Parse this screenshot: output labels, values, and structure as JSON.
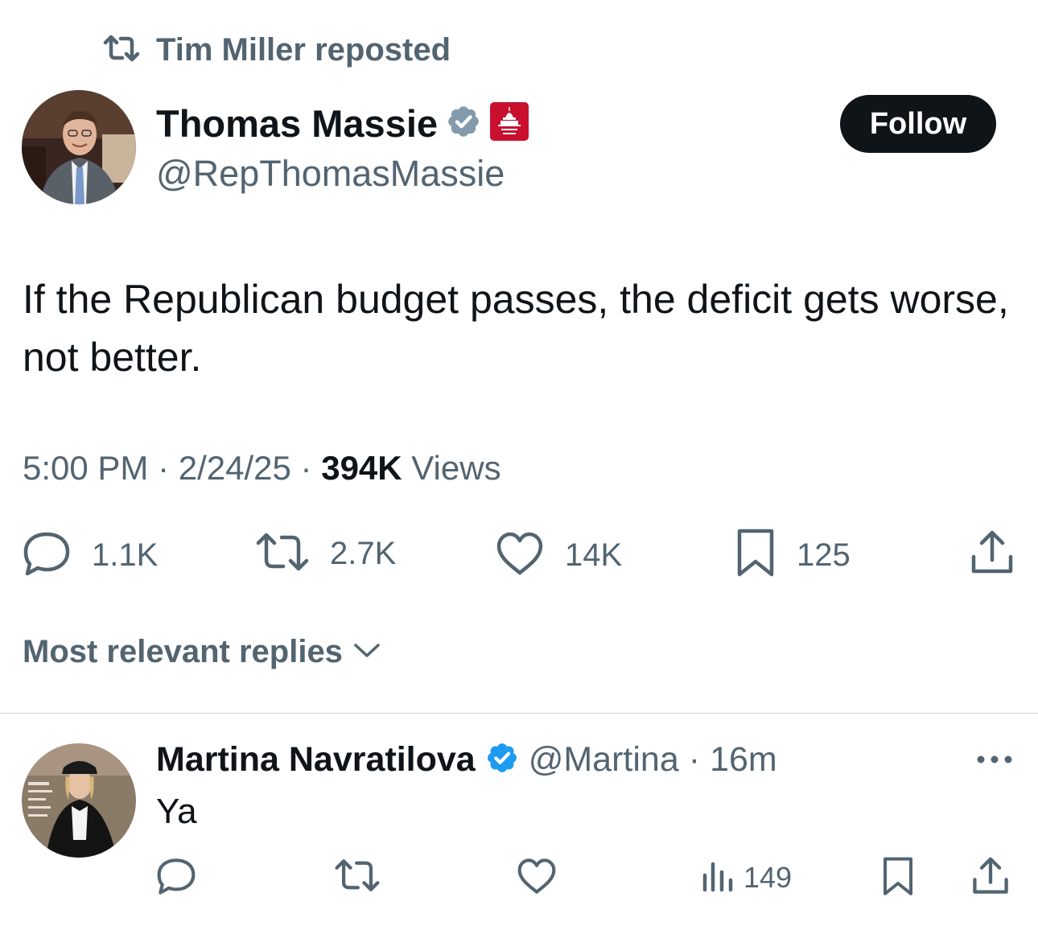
{
  "repost": {
    "text": "Tim Miller reposted",
    "icon": "repost-icon"
  },
  "tweet": {
    "author_name": "Thomas Massie",
    "handle": "@RepThomasMassie",
    "affiliation_badge": "HOUSE GOP",
    "follow_label": "Follow",
    "text": "If the Republican budget passes, the deficit gets worse, not better.",
    "time": "5:00 PM",
    "date": "2/24/25",
    "views_count": "394K",
    "views_label": "Views",
    "stats": {
      "replies": "1.1K",
      "reposts": "2.7K",
      "likes": "14K",
      "bookmarks": "125"
    }
  },
  "replies_sort": {
    "label": "Most relevant replies"
  },
  "reply": {
    "author_name": "Martina Navratilova",
    "handle": "@Martina",
    "time": "16m",
    "text": "Ya",
    "views": "149"
  },
  "colors": {
    "text_primary": "#0f1419",
    "text_muted": "#536471",
    "verified_blue": "#1d9bf0",
    "gov_gray": "#829aab",
    "gop_red": "#c8102e",
    "divider": "#cfd9de"
  }
}
